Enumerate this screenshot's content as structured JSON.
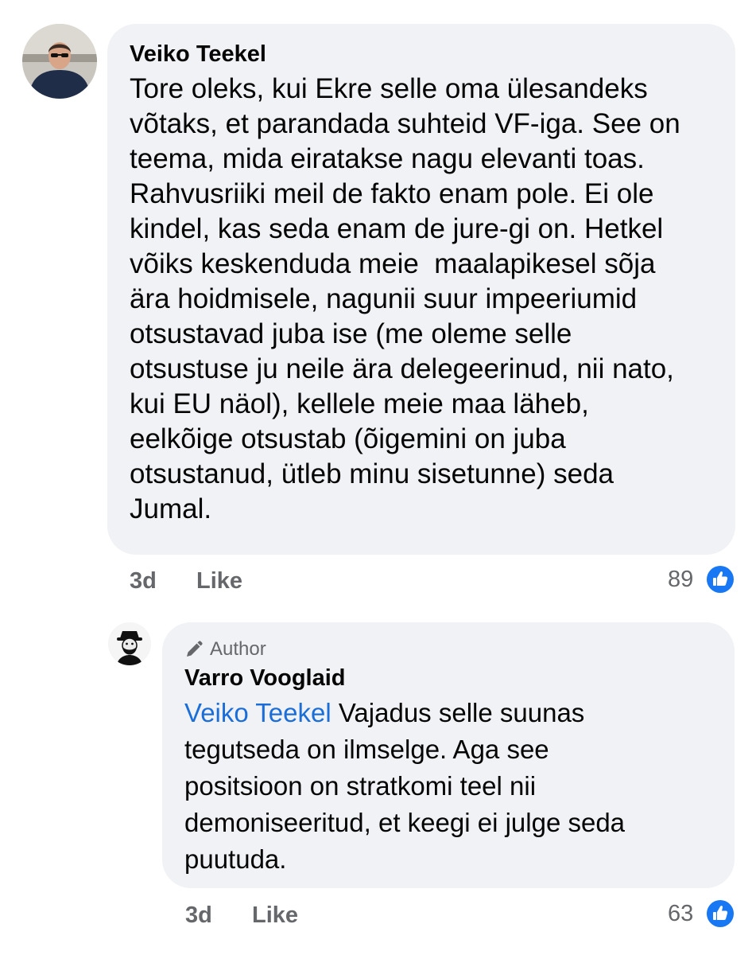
{
  "comment": {
    "author": "Veiko Teekel",
    "lines": [
      "Tore oleks, kui Ekre selle oma ülesandeks",
      "võtaks, et parandada suhteid VF-iga. See on",
      "teema, mida eiratakse nagu elevanti toas.",
      "Rahvusriiki meil de fakto enam pole. Ei ole",
      "kindel, kas seda enam de jure-gi on. Hetkel",
      "võiks keskenduda meie  maalapikesel sõja",
      "ära hoidmisele, nagunii suur impeeriumid",
      "otsustavad juba ise (me oleme selle",
      "otsustuse ju neile ära delegeerinud, nii nato,",
      "kui EU näol), kellele meie maa läheb,",
      "eelkõige otsustab (õigemini on juba",
      "otsustanud, ütleb minu sisetunne) seda",
      "Jumal."
    ],
    "time": "3d",
    "like_label": "Like",
    "reaction_count": "89"
  },
  "reply": {
    "badge": "Author",
    "author": "Varro Vooglaid",
    "mention": "Veiko Teekel",
    "first_line_rest": " Vajadus selle suunas",
    "lines": [
      "tegutseda on ilmselge. Aga see",
      "positsioon on stratkomi teel nii",
      "demoniseeritud, et keegi ei julge seda",
      "puutuda."
    ],
    "time": "3d",
    "like_label": "Like",
    "reaction_count": "63"
  },
  "colors": {
    "bubble": "#f0f2f5",
    "mention": "#1b6ed8",
    "meta": "#65676b",
    "like_blue": "#1877f2"
  },
  "icons": [
    "avatar-veiko",
    "avatar-varro",
    "pencil-icon",
    "thumbs-up-icon"
  ]
}
